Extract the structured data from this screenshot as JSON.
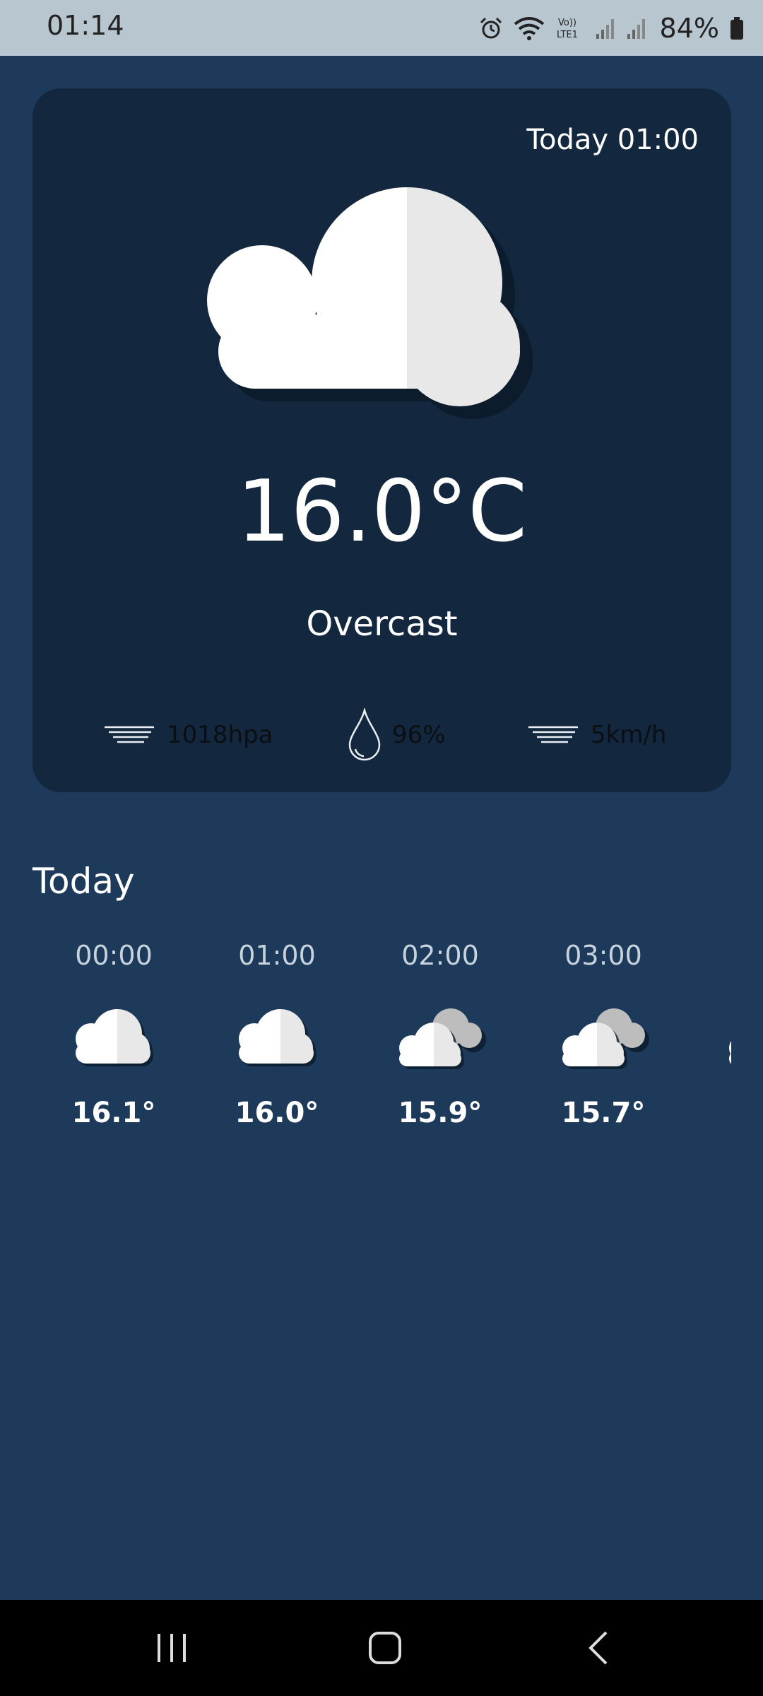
{
  "status_bar": {
    "time": "01:14",
    "battery_percent": "84%",
    "icons": [
      "alarm-icon",
      "wifi-icon",
      "volte-icon",
      "signal-icon",
      "signal-icon",
      "battery-icon"
    ]
  },
  "current": {
    "timestamp": "Today 01:00",
    "icon": "cloud-icon",
    "temperature": "16.0°C",
    "condition": "Overcast",
    "pressure": "1018hpa",
    "humidity": "96%",
    "wind": "5km/h"
  },
  "hourly": {
    "title": "Today",
    "items": [
      {
        "time": "00:00",
        "icon": "cloud-icon",
        "temp": "16.1°"
      },
      {
        "time": "01:00",
        "icon": "cloud-icon",
        "temp": "16.0°"
      },
      {
        "time": "02:00",
        "icon": "clouds-icon",
        "temp": "15.9°"
      },
      {
        "time": "03:00",
        "icon": "clouds-icon",
        "temp": "15.7°"
      }
    ]
  },
  "colors": {
    "background": "#1d3a5a",
    "card": "#13273e",
    "status_bar": "#b8c6d0"
  }
}
